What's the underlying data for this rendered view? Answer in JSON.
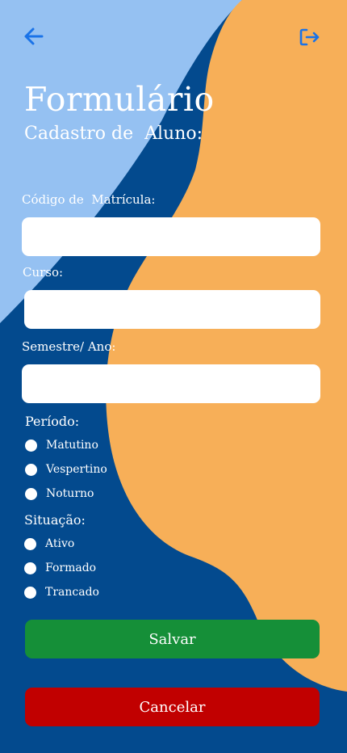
{
  "header": {
    "title": "Formulário",
    "subtitle": "Cadastro de  Aluno:"
  },
  "icons": {
    "back": "arrow-left-icon",
    "logout": "logout-icon"
  },
  "form": {
    "matricula": {
      "label": "Código de  Matrícula:",
      "value": ""
    },
    "curso": {
      "label": "Curso:",
      "value": ""
    },
    "semestre": {
      "label": "Semestre/ Ano:",
      "value": ""
    },
    "periodo": {
      "label": "Período:",
      "options": [
        "Matutino",
        "Vespertino",
        "Noturno"
      ]
    },
    "situacao": {
      "label": "Situação:",
      "options": [
        "Ativo",
        "Formado",
        "Trancado"
      ]
    }
  },
  "actions": {
    "save": "Salvar",
    "cancel": "Cancelar"
  },
  "colors": {
    "background_dark_blue": "#034a8e",
    "light_blue_shape": "#95c1f2",
    "orange_shape": "#f7af58",
    "icon_blue": "#1a73e8",
    "save_green": "#158f38",
    "cancel_red": "#c10000"
  }
}
